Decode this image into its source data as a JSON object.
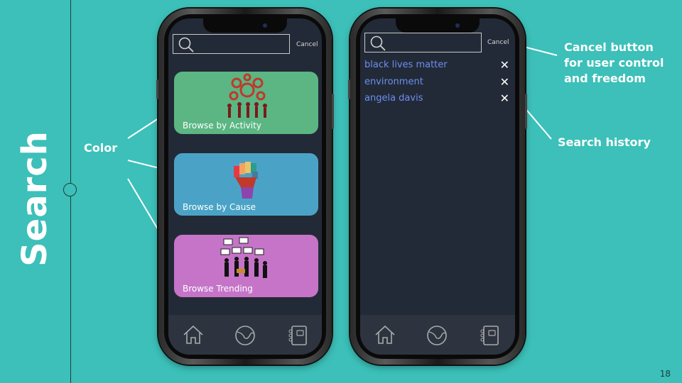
{
  "slide": {
    "title": "Search",
    "page_number": "18",
    "annotations": {
      "color": "Color",
      "cancel": "Cancel button for user control and freedom",
      "history": "Search history"
    }
  },
  "phone_left": {
    "search": {
      "placeholder": "",
      "cancel_label": "Cancel"
    },
    "cards": [
      {
        "label": "Browse by Activity",
        "color": "#5bb683",
        "icon": "gears-people-icon"
      },
      {
        "label": "Browse by Cause",
        "color": "#4aa3c6",
        "icon": "raised-fist-icon"
      },
      {
        "label": "Browse Trending",
        "color": "#c574c8",
        "icon": "protest-crowd-icon"
      }
    ],
    "nav": [
      {
        "icon": "home-icon"
      },
      {
        "icon": "globe-icon"
      },
      {
        "icon": "notebook-icon"
      }
    ]
  },
  "phone_right": {
    "search": {
      "placeholder": "",
      "cancel_label": "Cancel"
    },
    "history": [
      {
        "text": "black lives matter",
        "remove": "✕"
      },
      {
        "text": "environment",
        "remove": "✕"
      },
      {
        "text": "angela davis",
        "remove": "✕"
      }
    ],
    "nav": [
      {
        "icon": "home-icon"
      },
      {
        "icon": "globe-icon"
      },
      {
        "icon": "notebook-icon"
      }
    ]
  },
  "colors": {
    "background": "#3cc0b9",
    "screen": "#232a37",
    "nav_bar": "#2d3440",
    "history_link": "#6a8ff0"
  }
}
